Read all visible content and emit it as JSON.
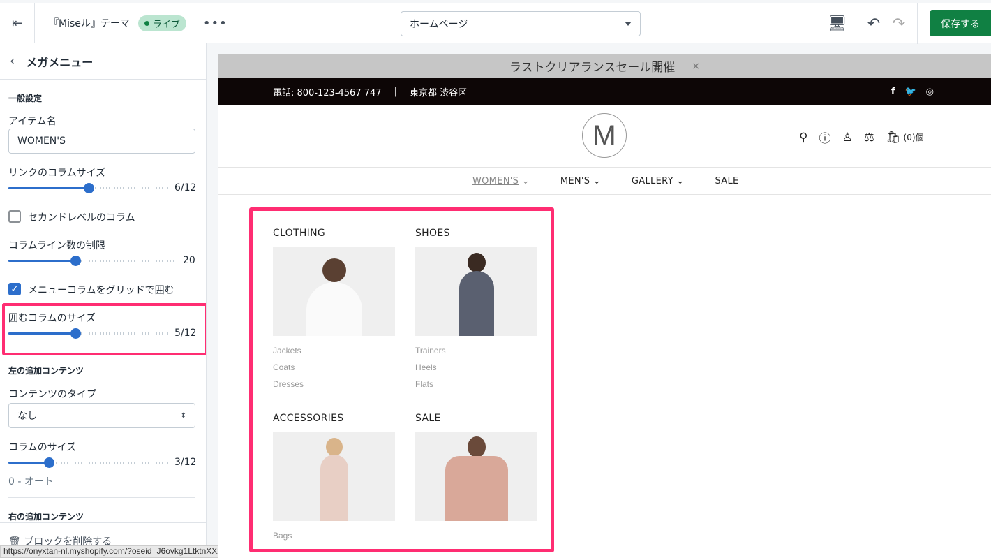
{
  "topbar": {
    "theme_name": "『Miseル』テーマ",
    "status_badge": "ライブ",
    "page_select": "ホームページ",
    "save_label": "保存する"
  },
  "sidebar": {
    "title": "メガメニュー",
    "general_heading": "一般設定",
    "item_name_label": "アイテム名",
    "item_name_value": "WOMEN'S",
    "link_col_label": "リンクのコラムサイズ",
    "link_col_value": "6/12",
    "link_col_fraction": 0.5,
    "second_level_label": "セカンドレベルのコラム",
    "second_level_checked": false,
    "col_line_label": "コラムライン数の制限",
    "col_line_value": "20",
    "col_line_fraction": 0.4,
    "grid_label": "メニューコラムをグリッドで囲む",
    "grid_checked": true,
    "wrap_col_label": "囲むコラムのサイズ",
    "wrap_col_value": "5/12",
    "wrap_col_fraction": 0.4167,
    "left_heading": "左の追加コンテンツ",
    "content_type_label": "コンテンツのタイプ",
    "content_type_value": "なし",
    "col_size_label": "コラムのサイズ",
    "col_size_value": "3/12",
    "col_size_fraction": 0.25,
    "col_size_hint": "0 - オート",
    "right_heading": "右の追加コンテンツ",
    "delete_label": "ブロックを削除する"
  },
  "status_url": "https://onyxtan-nl.myshopify.com/?oseid=J6ovkg1LtktnXXzoKvTMIVVP#",
  "preview": {
    "announcement": "ラストクリアランスセール開催",
    "close": "×",
    "phone": "電話: 800-123-4567 747",
    "sep": "|",
    "location": "東京都 渋谷区",
    "social": [
      "f",
      "t",
      "ig"
    ],
    "logo": "M",
    "cart_count": "(0)個",
    "nav": [
      "WOMEN'S",
      "MEN'S",
      "GALLERY",
      "SALE"
    ],
    "mega": [
      {
        "title": "CLOTHING",
        "links": [
          "Jackets",
          "Coats",
          "Dresses"
        ]
      },
      {
        "title": "SHOES",
        "links": [
          "Trainers",
          "Heels",
          "Flats"
        ]
      },
      {
        "title": "ACCESSORIES",
        "links": [
          "Bags"
        ]
      },
      {
        "title": "SALE",
        "links": []
      }
    ]
  },
  "colors": {
    "accent": "#2c6ecb",
    "save": "#108043",
    "highlight": "#ff2d72"
  }
}
